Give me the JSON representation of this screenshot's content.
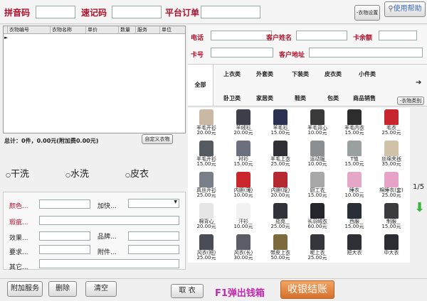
{
  "top": {
    "pinyin_label": "拼音码",
    "quick_label": "速记码",
    "platform_label": "平台订单",
    "pinyin_value": "",
    "quick_value": "",
    "platform_value": "",
    "clothes_settings_btn": "-衣物设置",
    "help_btn": "使用帮助"
  },
  "grid": {
    "columns": [
      "衣物编号",
      "衣物名称",
      "单价",
      "数量",
      "服务",
      "单位"
    ]
  },
  "summary": {
    "text": "总计：0件，0.00元(附加费0.00元)",
    "custom_btn": "自定义衣物"
  },
  "service_types": [
    "干洗",
    "水洗",
    "皮衣"
  ],
  "form": {
    "color_label": "颜色...",
    "flaw_label": "瑕疵...",
    "effect_label": "效果...",
    "request_label": "要求...",
    "other_label": "其它...",
    "urgent_label": "加快...",
    "brand_label": "品牌...",
    "attachment_label": "附件..."
  },
  "customer": {
    "phone_label": "电话",
    "name_label": "客户姓名",
    "balance_label": "卡余额",
    "card_label": "卡号",
    "address_label": "客户地址"
  },
  "categories": {
    "all": "全部",
    "row1": [
      "上衣类",
      "外套类",
      "下装类",
      "皮衣类",
      "小件类"
    ],
    "row2": [
      "卧卫类",
      "家居类",
      "鞋类",
      "包类",
      "商品销售"
    ],
    "category_btn": "-衣物类别"
  },
  "products": [
    {
      "name": "羊毛开衫",
      "price": "20.00元",
      "color": "#c9b9a4"
    },
    {
      "name": "羊绒衫",
      "price": "20.00元",
      "color": "#3d4048"
    },
    {
      "name": "羊毛衫",
      "price": "15.00元",
      "color": "#2b3150"
    },
    {
      "name": "羊毛背心",
      "price": "10.00元",
      "color": "#3a3a3a"
    },
    {
      "name": "羊毛内衣",
      "price": "15.00元",
      "color": "#2d2d2d"
    },
    {
      "name": "毛衣",
      "price": "25.00元",
      "color": "#c8262e"
    },
    {
      "name": "羊毛开衫",
      "price": "15.00元",
      "color": "#555a60"
    },
    {
      "name": "衬衫",
      "price": "15.00元",
      "color": "#6b6f7e"
    },
    {
      "name": "羊毛上衣",
      "price": "25.00元",
      "color": "#2f2f35"
    },
    {
      "name": "运动服",
      "price": "10.00元",
      "color": "#8b8f92"
    },
    {
      "name": "T恤",
      "price": "15.00元",
      "color": "#9aa0a0"
    },
    {
      "name": "丝绵夹袄",
      "price": "35.00元",
      "color": "#cfc2a8"
    },
    {
      "name": "真丝开衫",
      "price": "25.00元",
      "color": "#7a7e88"
    },
    {
      "name": "内胆(薄)",
      "price": "10.00元",
      "color": "#c9272d"
    },
    {
      "name": "内胆(厚)",
      "price": "20.00元",
      "color": "#b52a30"
    },
    {
      "name": "厨工衣",
      "price": "15.00元",
      "color": "#a8a8a8"
    },
    {
      "name": "睡衣",
      "price": "10.00元",
      "color": "#e4a7c8"
    },
    {
      "name": "棉睡衣(套)",
      "price": "25.00元",
      "color": "#e7a3c7"
    },
    {
      "name": "棉背心",
      "price": "20.00元",
      "color": "#e6e6e6"
    },
    {
      "name": "汗衫",
      "price": "10.00元",
      "color": "#f2f2f2"
    },
    {
      "name": "茄克",
      "price": "25.00元",
      "color": "#30343a"
    },
    {
      "name": "长羽绒衣",
      "price": "60.00元",
      "color": "#24262c"
    },
    {
      "name": "西服",
      "price": "15.00元",
      "color": "#2a2e36"
    },
    {
      "name": "制服",
      "price": "15.00元",
      "color": "#3a3a3f"
    },
    {
      "name": "风衣(短)",
      "price": "25.00元",
      "color": "#4a4d55"
    },
    {
      "name": "风衣(长)",
      "price": "30.00元",
      "color": "#5a5d66"
    },
    {
      "name": "带皮上衣",
      "price": "50.00元",
      "color": "#7c6a3c"
    },
    {
      "name": "呢上衣",
      "price": "25.00元",
      "color": "#34363c"
    },
    {
      "name": "短大衣",
      "price": "",
      "color": "#2e3036"
    },
    {
      "name": "中大衣",
      "price": "",
      "color": "#2b2d33"
    }
  ],
  "pager": "1/5",
  "bottom": {
    "extra_btn": "附加服务",
    "delete_btn": "删除",
    "clear_btn": "清空",
    "pickup_btn": "取 衣",
    "f1_text": "F1弹出钱箱",
    "checkout_btn": "收银结账"
  }
}
